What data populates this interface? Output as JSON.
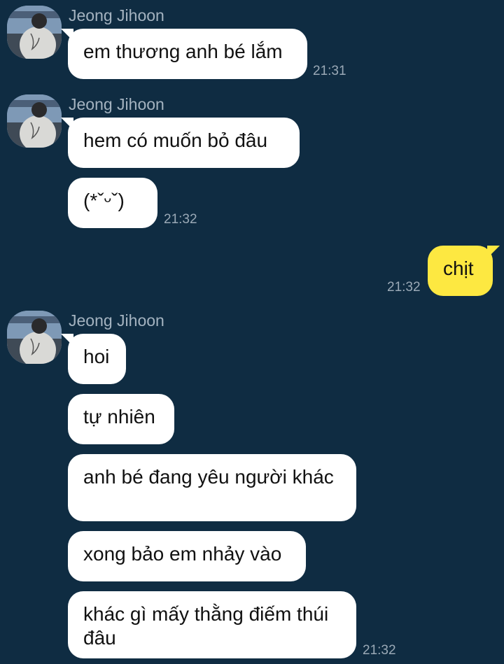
{
  "sender_name": "Jeong Jihoon",
  "groups": [
    {
      "messages": [
        {
          "text": "em thương anh bé lắm"
        }
      ],
      "time": "21:31"
    },
    {
      "messages": [
        {
          "text": "hem có muốn bỏ đâu"
        },
        {
          "text": "(*ˇᵕˇ)"
        }
      ],
      "time": "21:32"
    },
    {
      "messages": [
        {
          "text": "hoi"
        },
        {
          "text": "tự nhiên"
        },
        {
          "text": "anh bé đang yêu người khác"
        },
        {
          "text": "xong bảo em nhảy vào"
        },
        {
          "text": "khác gì mấy thằng điếm thúi đâu"
        }
      ],
      "time": "21:32"
    }
  ],
  "my_message": {
    "text": "chịt",
    "time": "21:32"
  },
  "colors": {
    "background": "#0f2c42",
    "incoming_bubble": "#ffffff",
    "outgoing_bubble": "#fde841",
    "name_text": "#a4b3c0",
    "time_text": "#9aa9b6"
  },
  "icons": {
    "avatar": "profile-photo"
  }
}
